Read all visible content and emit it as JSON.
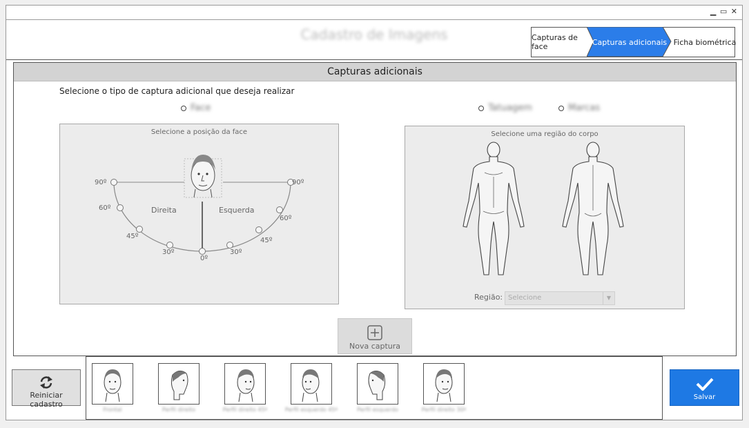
{
  "window": {
    "controls": [
      "▁",
      "▭",
      "✕"
    ]
  },
  "header": {
    "title": "Cadastro de Imagens"
  },
  "stepper": {
    "steps": [
      "Capturas de face",
      "Capturas adicionais",
      "Ficha biométrica"
    ],
    "active_index": 1,
    "active_color": "#2b7de9"
  },
  "panel": {
    "heading": "Capturas adicionais",
    "instruction": "Selecione o tipo de captura adicional que deseja realizar",
    "radios": {
      "face": "Face",
      "tatuagem": "Tatuagem",
      "marcas": "Marcas"
    },
    "face_box": {
      "caption": "Selecione a posição da face",
      "direita": "Direita",
      "esquerda": "Esquerda",
      "angles": {
        "l90": "90º",
        "l60": "60º",
        "l45": "45º",
        "l30": "30º",
        "c0": "0º",
        "r30": "30º",
        "r45": "45º",
        "r60": "60º",
        "r90": "90º"
      }
    },
    "body_box": {
      "caption": "Selecione uma região do corpo",
      "region_label": "Região:",
      "region_placeholder": "Selecione"
    },
    "nova_captura": "Nova captura"
  },
  "footer": {
    "reiniciar": "Reiniciar cadastro",
    "salvar": "Salvar",
    "thumbnails": [
      "Frontal",
      "Perfil direito",
      "Perfil direito 45º",
      "Perfil esquerdo 45º",
      "Perfil esquerdo",
      "Perfil direito 30º"
    ]
  },
  "colors": {
    "accent": "#1e79e4"
  }
}
